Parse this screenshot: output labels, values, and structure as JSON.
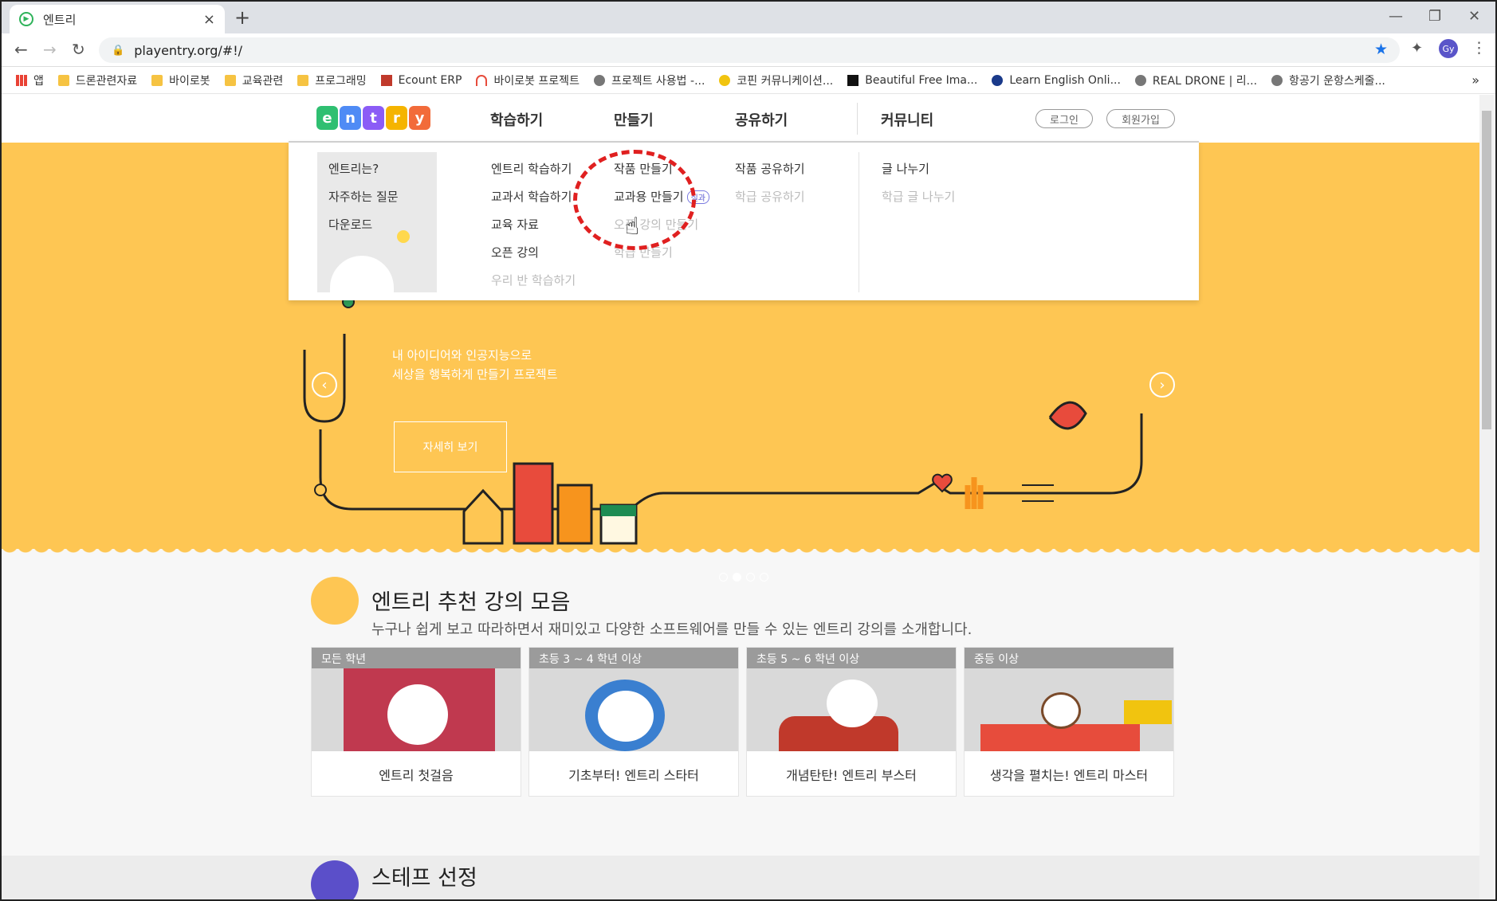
{
  "browser": {
    "tab_title": "엔트리",
    "url": "playentry.org/#!/",
    "avatar_text": "Gy"
  },
  "bookmarks": [
    {
      "label": "앱",
      "icon": "apps-icon"
    },
    {
      "label": "드론관련자료",
      "icon": "folder-icon"
    },
    {
      "label": "바이로봇",
      "icon": "folder-icon"
    },
    {
      "label": "교육관련",
      "icon": "folder-icon"
    },
    {
      "label": "프로그래밍",
      "icon": "folder-icon"
    },
    {
      "label": "Ecount ERP",
      "icon": "ecount-icon"
    },
    {
      "label": "바이로봇 프로젝트",
      "icon": "site-icon"
    },
    {
      "label": "프로젝트 사용법 -...",
      "icon": "globe-icon"
    },
    {
      "label": "코핀 커뮤니케이션...",
      "icon": "site-icon"
    },
    {
      "label": "Beautiful Free Ima...",
      "icon": "site-icon"
    },
    {
      "label": "Learn English Onli...",
      "icon": "site-icon"
    },
    {
      "label": "REAL DRONE | 리...",
      "icon": "globe-icon"
    },
    {
      "label": "항공기 운항스케줄...",
      "icon": "globe-icon"
    }
  ],
  "site": {
    "logo_letters": [
      "e",
      "n",
      "t",
      "r",
      "y"
    ],
    "logo_colors": [
      "#2fbf71",
      "#4f8bf5",
      "#8b5cf6",
      "#f5b400",
      "#f26b3a"
    ],
    "nav": {
      "learn": "학습하기",
      "make": "만들기",
      "share": "공유하기",
      "community": "커뮤니티",
      "login": "로그인",
      "signup": "회원가입"
    },
    "dropdown": {
      "about": [
        "엔트리는?",
        "자주하는 질문",
        "다운로드"
      ],
      "learn": [
        "엔트리 학습하기",
        "교과서 학습하기",
        "교육 자료",
        "오픈 강의",
        "우리 반 학습하기"
      ],
      "make": [
        "작품 만들기",
        "교과용 만들기",
        "오픈 강의 만들기",
        "학급 만들기"
      ],
      "make_badge": "실과",
      "share": [
        "작품 공유하기",
        "학급 공유하기"
      ],
      "community": [
        "글 나누기",
        "학급 글 나누기"
      ]
    },
    "hero": {
      "line1": "내 아이디어와 인공지능으로",
      "line2": "세상을 행복하게 만들기 프로젝트",
      "button": "자세히 보기",
      "active_slide": 2,
      "slides": 4
    },
    "section": {
      "title": "엔트리 추천 강의 모음",
      "desc": "누구나 쉽게 보고 따라하면서 재미있고 다양한 소프트웨어를 만들 수 있는 엔트리 강의를 소개합니다."
    },
    "cards": [
      {
        "label": "모든 학년",
        "title": "엔트리 첫걸음"
      },
      {
        "label": "초등 3 ~ 4 학년 이상",
        "title": "기초부터! 엔트리 스타터"
      },
      {
        "label": "초등 5 ~ 6 학년 이상",
        "title": "개념탄탄! 엔트리 부스터"
      },
      {
        "label": "중등 이상",
        "title": "생각을 펼치는! 엔트리 마스터"
      }
    ],
    "partial_next_title": "스테프 선정"
  }
}
